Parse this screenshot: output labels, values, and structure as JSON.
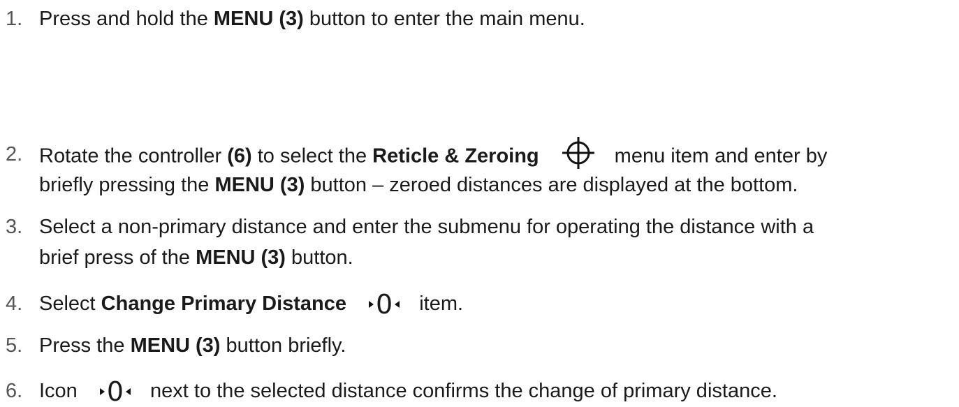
{
  "steps": [
    {
      "num": "1.",
      "p1": "Press and hold the ",
      "b1": "MENU (3)",
      "p2": " button to enter the main menu."
    },
    {
      "num": "2.",
      "p1": "Rotate the controller ",
      "b1": "(6)",
      "p2": " to select the ",
      "b2": "Reticle & Zeroing",
      "icon": "crosshair-icon",
      "p3": "menu item and enter by",
      "line2_p1": "briefly pressing the ",
      "line2_b1": "MENU (3)",
      "line2_p2": " button – zeroed distances are displayed at the bottom."
    },
    {
      "num": "3.",
      "p1": "Select a non-primary distance and enter the submenu for operating the distance with a",
      "line2_p1": "brief press of the ",
      "line2_b1": "MENU (3)",
      "line2_p2": " button."
    },
    {
      "num": "4.",
      "p1": "Select ",
      "b1": "Change Primary Distance",
      "icon": "primary-distance-icon",
      "icon_text": "0",
      "p2": "item."
    },
    {
      "num": "5.",
      "p1": "Press the ",
      "b1": "MENU (3)",
      "p2": " button briefly."
    },
    {
      "num": "6.",
      "p1": "Icon",
      "icon": "primary-distance-icon",
      "icon_text": "0",
      "p2": "next to the selected distance confirms the change of primary distance."
    }
  ]
}
